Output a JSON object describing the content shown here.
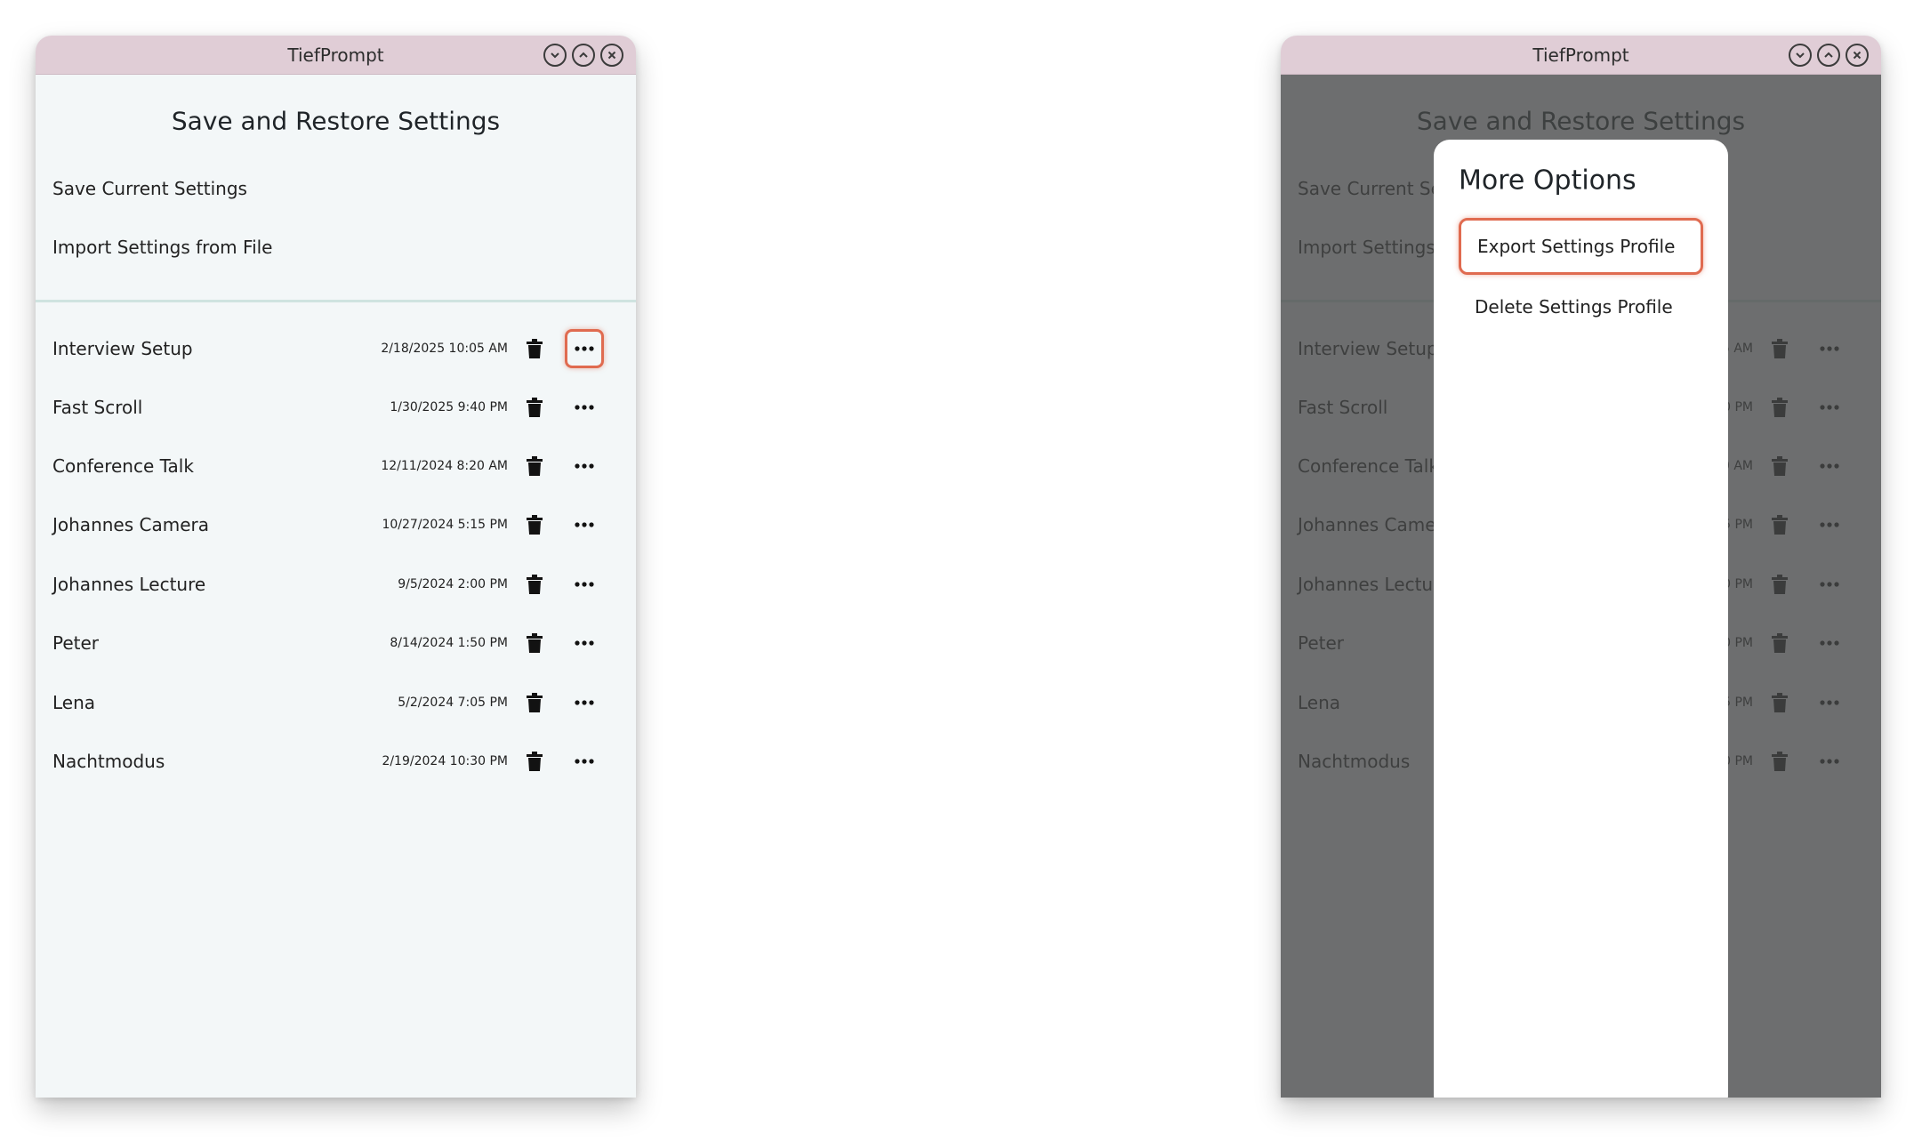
{
  "app": {
    "title": "TiefPrompt"
  },
  "page": {
    "title": "Save and Restore Settings",
    "actions": {
      "save": "Save Current Settings",
      "import": "Import Settings from File"
    }
  },
  "profiles": [
    {
      "name": "Interview Setup",
      "date": "2/18/2025 10:05 AM"
    },
    {
      "name": "Fast Scroll",
      "date": "1/30/2025 9:40 PM"
    },
    {
      "name": "Conference Talk",
      "date": "12/11/2024 8:20 AM"
    },
    {
      "name": "Johannes Camera",
      "date": "10/27/2024 5:15 PM"
    },
    {
      "name": "Johannes Lecture",
      "date": "9/5/2024 2:00 PM"
    },
    {
      "name": "Peter",
      "date": "8/14/2024 1:50 PM"
    },
    {
      "name": "Lena",
      "date": "5/2/2024 7:05 PM"
    },
    {
      "name": "Nachtmodus",
      "date": "2/19/2024 10:30 PM"
    }
  ],
  "modal": {
    "title": "More Options",
    "options": {
      "export": "Export Settings Profile",
      "delete": "Delete Settings Profile"
    }
  },
  "icons": {
    "minimize": "chevron-down-icon",
    "maximize": "chevron-up-icon",
    "close": "close-icon",
    "delete": "trash-icon",
    "more": "more-horizontal-icon"
  },
  "colors": {
    "titlebar": "#e0cdd6",
    "window_bg": "#f3f7f8",
    "highlight": "#e06b50",
    "overlay": "#464848"
  }
}
